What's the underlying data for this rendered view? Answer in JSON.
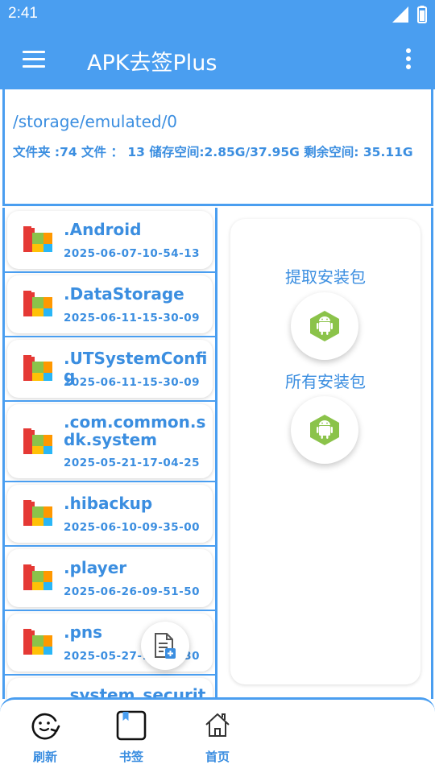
{
  "status_bar": {
    "time": "2:41"
  },
  "app_bar": {
    "title": "APK去签Plus"
  },
  "path_info": {
    "path": "/storage/emulated/0",
    "stats": "文件夹 :74    文件 ： 13    储存空间:2.85G/37.95G  剩余空间: 35.11G"
  },
  "folders": [
    {
      "name": ".Android",
      "date": "2025-06-07-10-54-13"
    },
    {
      "name": ".DataStorage",
      "date": "2025-06-11-15-30-09"
    },
    {
      "name": ".UTSystemConfig",
      "date": "2025-06-11-15-30-09"
    },
    {
      "name": ".com.common.sdk.system",
      "date": "2025-05-21-17-04-25"
    },
    {
      "name": ".hibackup",
      "date": "2025-06-10-09-35-00"
    },
    {
      "name": ".player",
      "date": "2025-06-26-09-51-50"
    },
    {
      "name": ".pns",
      "date": "2025-05-27-11-40-30"
    },
    {
      "name": ".system_security",
      "date": ""
    }
  ],
  "actions": {
    "extract_label": "提取安装包",
    "all_label": "所有安装包"
  },
  "bottom_nav": [
    {
      "label": "刷新",
      "icon": "refresh-face-icon"
    },
    {
      "label": "书签",
      "icon": "bookmark-icon"
    },
    {
      "label": "首页",
      "icon": "home-icon"
    }
  ],
  "colors": {
    "primary": "#4a9ef0",
    "text_blue": "#3b8ee0",
    "android_green": "#8bc34a"
  }
}
